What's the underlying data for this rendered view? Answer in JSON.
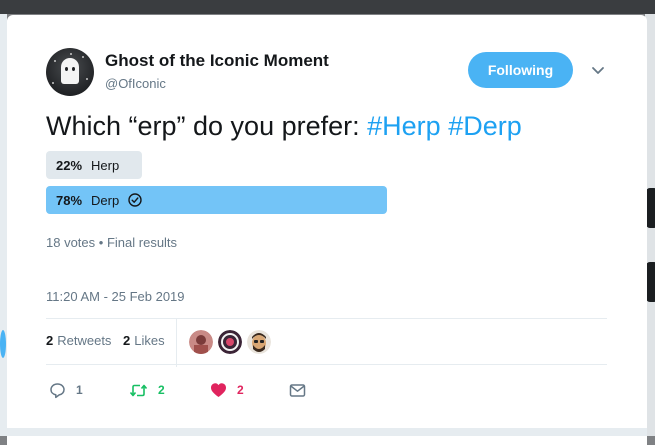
{
  "author": {
    "name": "Ghost of the Iconic Moment",
    "handle": "@OfIconic"
  },
  "follow_button": {
    "label": "Following"
  },
  "tweet": {
    "text": "Which “erp” do you prefer:",
    "hashtags": [
      "#Herp",
      "#Derp"
    ]
  },
  "poll": {
    "options": [
      {
        "percent_label": "22%",
        "percent": 22,
        "label": "Herp",
        "winner": false
      },
      {
        "percent_label": "78%",
        "percent": 78,
        "label": "Derp",
        "winner": true
      }
    ],
    "votes": "18 votes",
    "separator": "•",
    "status": "Final results"
  },
  "timestamp": "11:20 AM - 25 Feb 2019",
  "stats": {
    "retweets_count": "2",
    "retweets_label": "Retweets",
    "likes_count": "2",
    "likes_label": "Likes"
  },
  "actions": {
    "reply_count": "1",
    "retweet_count": "2",
    "like_count": "2"
  },
  "colors": {
    "accent": "#1da1f2",
    "follow_button": "#4ab3f4",
    "poll_winner": "#73c4f7",
    "poll_other": "#e1e8ed",
    "retweet_green": "#17bf63",
    "like_red": "#e0245e"
  },
  "icons": [
    "chevron-down-icon",
    "check-circle-icon",
    "reply-icon",
    "retweet-icon",
    "heart-icon",
    "message-icon"
  ]
}
